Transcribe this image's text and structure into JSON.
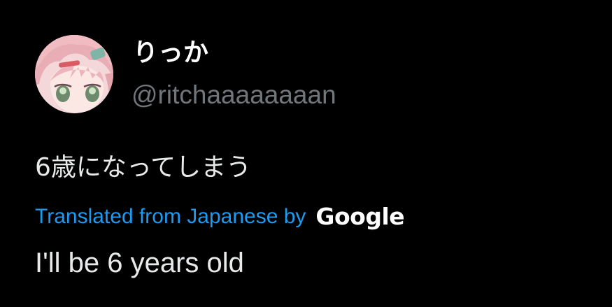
{
  "author": {
    "display_name": "りっか",
    "handle": "@ritchaaaaaaaan",
    "avatar_icon": "anime-avatar-icon"
  },
  "tweet": {
    "text": "6歳になってしまう"
  },
  "translation": {
    "label": "Translated from Japanese by",
    "provider": "Google",
    "text": "I'll be 6 years old"
  },
  "colors": {
    "background": "#000000",
    "text": "#e7e9ea",
    "secondary_text": "#71767b",
    "link": "#1d9bf0"
  }
}
